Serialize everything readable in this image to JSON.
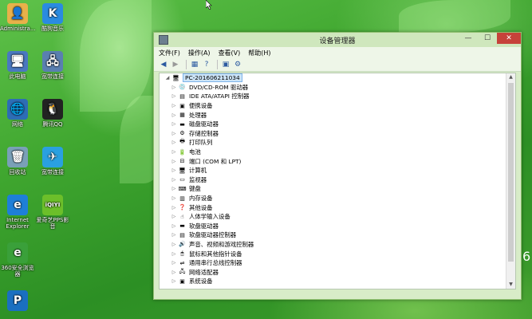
{
  "desktop": {
    "icons": [
      {
        "label": "Administra...",
        "symbol": "👤",
        "color": "#e8b14a"
      },
      {
        "label": "酷狗音乐",
        "symbol": "K",
        "color": "#2a8be0"
      },
      {
        "label": "此电脑",
        "symbol": "🖥",
        "color": "#4a78c0"
      },
      {
        "label": "宽带连接",
        "symbol": "🖧",
        "color": "#5a7fb0"
      },
      {
        "label": "网络",
        "symbol": "🌐",
        "color": "#2d6db5"
      },
      {
        "label": "腾讯QQ",
        "symbol": "🐧",
        "color": "#222222"
      },
      {
        "label": "回收站",
        "symbol": "🗑",
        "color": "#7aa0b8"
      },
      {
        "label": "宽带连接",
        "symbol": "✈",
        "color": "#2aa0e0"
      },
      {
        "label": "Internet Explorer",
        "symbol": "e",
        "color": "#1e7fd8"
      },
      {
        "label": "爱奇艺PPS影音",
        "symbol": "iQIYI",
        "color": "#6cbf2a"
      },
      {
        "label": "360安全浏览器",
        "symbol": "e",
        "color": "#3aa03a"
      },
      {
        "label": "",
        "symbol": "P",
        "color": "#1a6fc0"
      }
    ],
    "side_text": "6"
  },
  "window": {
    "title": "设备管理器",
    "controls": {
      "minimize": "—",
      "maximize": "☐",
      "close": "✕"
    },
    "menu": [
      "文件(F)",
      "操作(A)",
      "查看(V)",
      "帮助(H)"
    ],
    "toolbar": [
      {
        "name": "back-icon",
        "glyph": "◀",
        "disabled": false
      },
      {
        "name": "forward-icon",
        "glyph": "▶",
        "disabled": true
      },
      {
        "name": "properties-icon",
        "glyph": "▦",
        "disabled": false
      },
      {
        "name": "help-icon",
        "glyph": "?",
        "disabled": false
      },
      {
        "name": "view-icon",
        "glyph": "▣",
        "disabled": false
      },
      {
        "name": "scan-hardware-icon",
        "glyph": "⚙",
        "disabled": false
      }
    ],
    "tree": {
      "root": "PC-201606211034",
      "children": [
        {
          "label": "DVD/CD-ROM 驱动器",
          "icon": "💿"
        },
        {
          "label": "IDE ATA/ATAPI 控制器",
          "icon": "▤"
        },
        {
          "label": "便携设备",
          "icon": "▣"
        },
        {
          "label": "处理器",
          "icon": "▦"
        },
        {
          "label": "磁盘驱动器",
          "icon": "▬"
        },
        {
          "label": "存储控制器",
          "icon": "⚙"
        },
        {
          "label": "打印队列",
          "icon": "🖶"
        },
        {
          "label": "电池",
          "icon": "🔋"
        },
        {
          "label": "端口 (COM 和 LPT)",
          "icon": "⊟"
        },
        {
          "label": "计算机",
          "icon": "🖥"
        },
        {
          "label": "监视器",
          "icon": "▭"
        },
        {
          "label": "键盘",
          "icon": "⌨"
        },
        {
          "label": "内存设备",
          "icon": "▥"
        },
        {
          "label": "其他设备",
          "icon": "❓"
        },
        {
          "label": "人体学输入设备",
          "icon": "☝"
        },
        {
          "label": "软盘驱动器",
          "icon": "▬"
        },
        {
          "label": "软盘驱动器控制器",
          "icon": "▤"
        },
        {
          "label": "声音、视频和游戏控制器",
          "icon": "🔊"
        },
        {
          "label": "鼠标和其他指针设备",
          "icon": "🖱"
        },
        {
          "label": "通用串行总线控制器",
          "icon": "⇌"
        },
        {
          "label": "网络适配器",
          "icon": "🖧"
        },
        {
          "label": "系统设备",
          "icon": "▣"
        }
      ]
    }
  }
}
